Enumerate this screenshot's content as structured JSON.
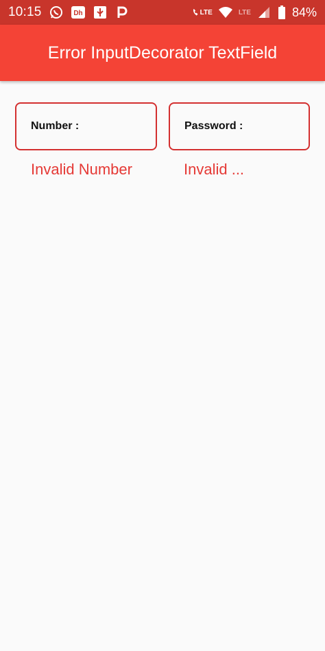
{
  "status_bar": {
    "time": "10:15",
    "lte_primary": "LTE",
    "lte_secondary": "LTE",
    "battery": "84%",
    "icons": [
      "whatsapp-icon",
      "app-icon",
      "usb-icon",
      "p-icon",
      "wifi-call-icon",
      "wifi-icon",
      "signal-icon",
      "battery-icon"
    ]
  },
  "app_bar": {
    "title": "Error InputDecorator TextField"
  },
  "fields": [
    {
      "label": "Number :",
      "error": "Invalid Number"
    },
    {
      "label": "Password :",
      "error": "Invalid ..."
    }
  ],
  "colors": {
    "status_bar": "#c8352b",
    "app_bar": "#f44336",
    "error": "#e53935",
    "border": "#d32f2f",
    "background": "#fafafa"
  }
}
